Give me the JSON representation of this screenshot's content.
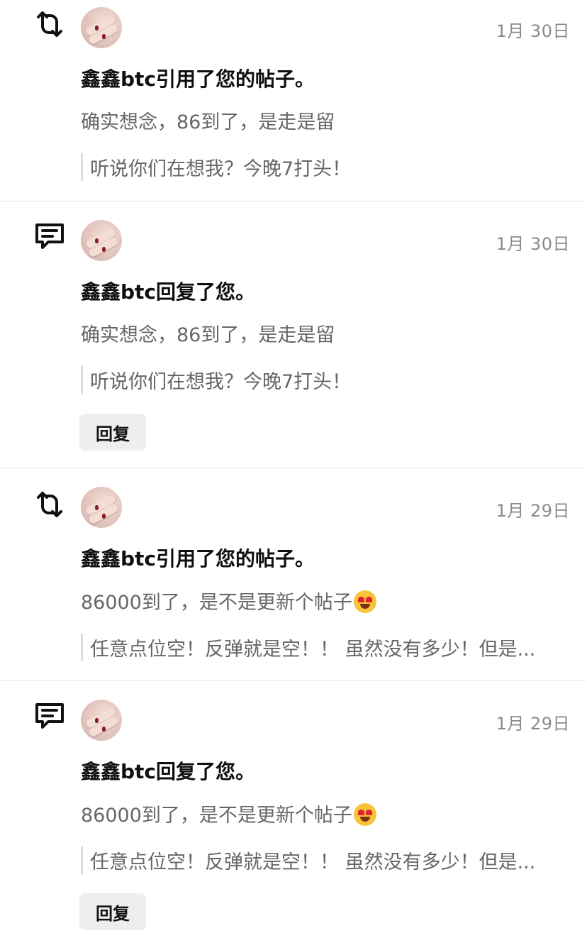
{
  "notifications": [
    {
      "type_icon": "repost-icon",
      "date": "1月 30日",
      "title": "鑫鑫btc引用了您的帖子。",
      "body": "确实想念，86到了，是走是留",
      "quote": "听说你们在想我？今晚7打头！"
    },
    {
      "type_icon": "comment-icon",
      "date": "1月 30日",
      "title": "鑫鑫btc回复了您。",
      "body": "确实想念，86到了，是走是留",
      "quote": "听说你们在想我？今晚7打头！",
      "reply_label": "回复"
    },
    {
      "type_icon": "repost-icon",
      "date": "1月 29日",
      "title": "鑫鑫btc引用了您的帖子。",
      "body": "86000到了，是不是更新个帖子",
      "body_emoji": "heart-eyes-emoji",
      "quote": "任意点位空！反弹就是空！！ 虽然没有多少！但是..."
    },
    {
      "type_icon": "comment-icon",
      "date": "1月 29日",
      "title": "鑫鑫btc回复了您。",
      "body": "86000到了，是不是更新个帖子",
      "body_emoji": "heart-eyes-emoji",
      "quote": "任意点位空！反弹就是空！！ 虽然没有多少！但是...",
      "reply_label": "回复"
    }
  ]
}
